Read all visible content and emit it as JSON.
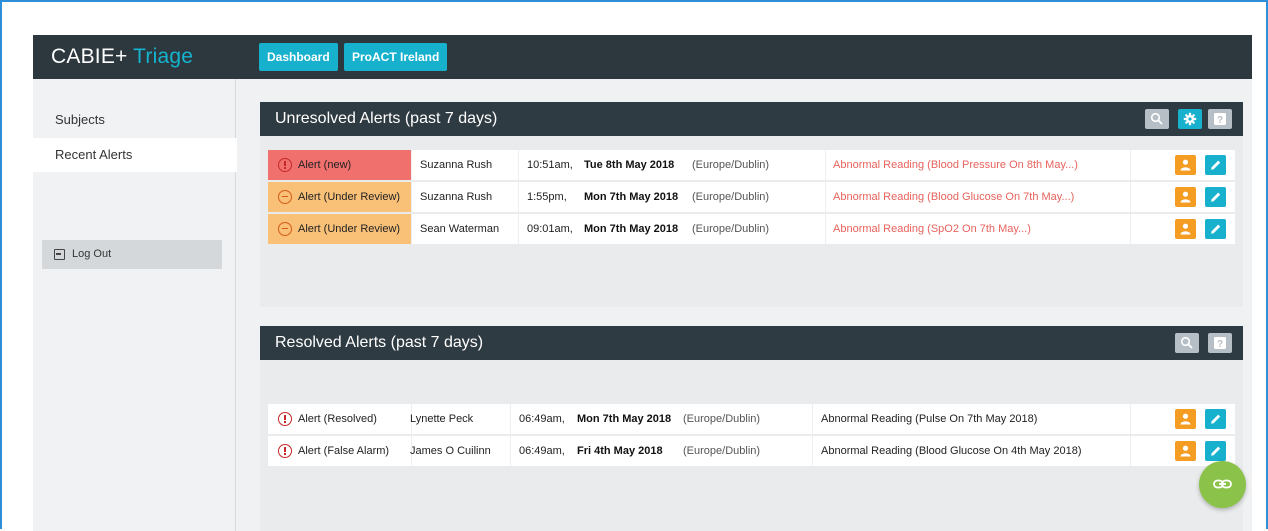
{
  "brand": {
    "name": "CABIE+",
    "accent": "Triage"
  },
  "nav": {
    "dashboard": "Dashboard",
    "proact": "ProACT Ireland"
  },
  "sidebar": {
    "subjects": "Subjects",
    "recent_alerts": "Recent Alerts",
    "logout": "Log Out"
  },
  "unresolved": {
    "title": "Unresolved Alerts (past 7 days)",
    "rows": [
      {
        "status": "Alert (new)",
        "status_type": "new",
        "name": "Suzanna Rush",
        "time": "10:51am,",
        "date": "Tue 8th May 2018",
        "tz": "(Europe/Dublin)",
        "reading": "Abnormal Reading (Blood Pressure On 8th May...)"
      },
      {
        "status": "Alert (Under Review)",
        "status_type": "review",
        "name": "Suzanna Rush",
        "time": "1:55pm,",
        "date": "Mon 7th May 2018",
        "tz": "(Europe/Dublin)",
        "reading": "Abnormal Reading (Blood Glucose On 7th May...)"
      },
      {
        "status": "Alert (Under Review)",
        "status_type": "review",
        "name": "Sean Waterman",
        "time": "09:01am,",
        "date": "Mon 7th May 2018",
        "tz": "(Europe/Dublin)",
        "reading": "Abnormal Reading (SpO2 On 7th May...)"
      }
    ]
  },
  "resolved": {
    "title": "Resolved Alerts (past 7 days)",
    "rows": [
      {
        "status": "Alert (Resolved)",
        "name": "Lynette Peck",
        "time": "06:49am,",
        "date": "Mon 7th May 2018",
        "tz": "(Europe/Dublin)",
        "reading": "Abnormal Reading (Pulse On 7th May 2018)"
      },
      {
        "status": "Alert (False Alarm)",
        "name": "James O Cuilinn",
        "time": "06:49am,",
        "date": "Fri 4th May 2018",
        "tz": "(Europe/Dublin)",
        "reading": "Abnormal Reading (Blood Glucose On 4th May 2018)"
      }
    ]
  },
  "colors": {
    "topbar": "#2c373e",
    "accent": "#15b4cf",
    "alert_new": "#f0706e",
    "alert_review": "#f9c178",
    "alert_text": "#e8625c",
    "subject_button": "#f59d23",
    "edit_button": "#17b1ce",
    "fab": "#8bc34a"
  },
  "icons": {
    "search": "search-icon",
    "settings": "gear-icon",
    "help": "help-icon",
    "subject": "person-icon",
    "edit": "pencil-icon",
    "link": "link-icon",
    "logout": "logout-icon"
  }
}
